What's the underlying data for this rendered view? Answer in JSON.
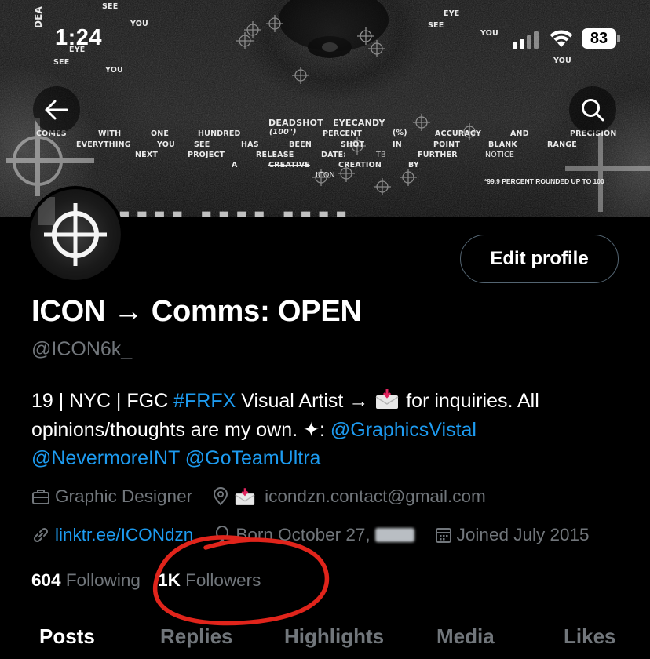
{
  "status_bar": {
    "time": "1:24",
    "battery": "83",
    "icons": [
      "signal-icon",
      "wifi-icon",
      "battery-icon"
    ]
  },
  "banner": {
    "words": [
      "DEA",
      "SEE",
      "YOU",
      "EYE",
      "SEE",
      "YOU",
      "EYE",
      "SEE",
      "YOU",
      "YOU",
      "DEADSHOT",
      "EYECANDY",
      "(100\")",
      "(%)",
      "COMES",
      "WITH",
      "ONE",
      "HUNDRED",
      "PERCENT",
      "ACCURACY",
      "AND",
      "PRECISION",
      "EVERYTHING",
      "YOU",
      "SEE",
      "HAS",
      "BEEN",
      "SHOT",
      "IN",
      "POINT",
      "BLANK",
      "RANGE",
      "NEXT",
      "PROJECT",
      "RELEASE",
      "DATE:",
      "FURTHER",
      "NOTICE",
      "A",
      "CREATIVE",
      "CREATION",
      "BY",
      "ICON",
      "TB"
    ],
    "footnote": "*99.9 PERCENT ROUNDED UP TO 100"
  },
  "nav": {
    "back_icon": "arrow-left-icon",
    "search_icon": "search-icon"
  },
  "profile": {
    "edit_button": "Edit profile",
    "display_name": "ICON → Comms: OPEN",
    "handle": "@ICON6k_",
    "bio": {
      "part1": "19 | NYC | FGC ",
      "hashtag": "#FRFX",
      "part2": " Visual Artist → ",
      "part3": " for inquiries. All opinions/thoughts are my own. ✦: ",
      "mention1": "@GraphicsVistal",
      "mention2": "@NevermoreINT",
      "mention3": "@GoTeamUltra"
    },
    "meta": {
      "profession": "Graphic Designer",
      "location": "icondzn.contact@gmail.com",
      "website": "linktr.ee/ICONdzn",
      "birthday": "Born October 27,",
      "joined": "Joined July 2015"
    },
    "following_count": "604",
    "following_label": "Following",
    "followers_count": "1K",
    "followers_label": "Followers"
  },
  "tabs": [
    "Posts",
    "Replies",
    "Highlights",
    "Media",
    "Likes"
  ],
  "active_tab": "Posts",
  "colors": {
    "background": "#000000",
    "text": "#ffffff",
    "secondary": "#71767b",
    "link": "#1d9bf0",
    "annotation": "#e0241b"
  }
}
